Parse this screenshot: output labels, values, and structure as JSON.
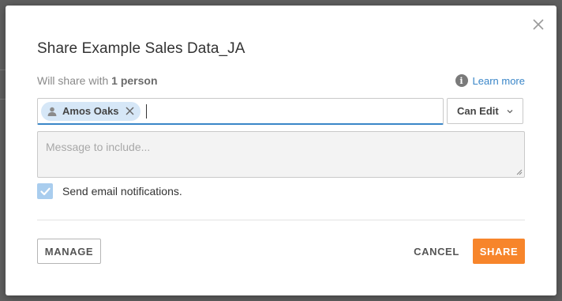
{
  "dialog": {
    "title": "Share Example Sales Data_JA",
    "share_with_prefix": "Will share with ",
    "share_with_count": "1 person",
    "learn_more": "Learn more",
    "recipients": [
      {
        "name": "Amos Oaks"
      }
    ],
    "permission": {
      "selected": "Can Edit"
    },
    "message_placeholder": "Message to include...",
    "notify": {
      "label": "Send email notifications.",
      "checked": true
    },
    "buttons": {
      "manage": "MANAGE",
      "cancel": "CANCEL",
      "share": "SHARE"
    }
  },
  "colors": {
    "accent": "#3a86c8",
    "primary_button": "#f7852b",
    "chip_bg": "#d6e7f7",
    "checkbox_checked": "#a9cdee"
  },
  "icons": {
    "close": "close-icon",
    "info": "info-icon",
    "person": "person-icon",
    "remove": "remove-chip-icon",
    "dropdown": "chevron-down-icon",
    "check": "checkmark-icon"
  }
}
